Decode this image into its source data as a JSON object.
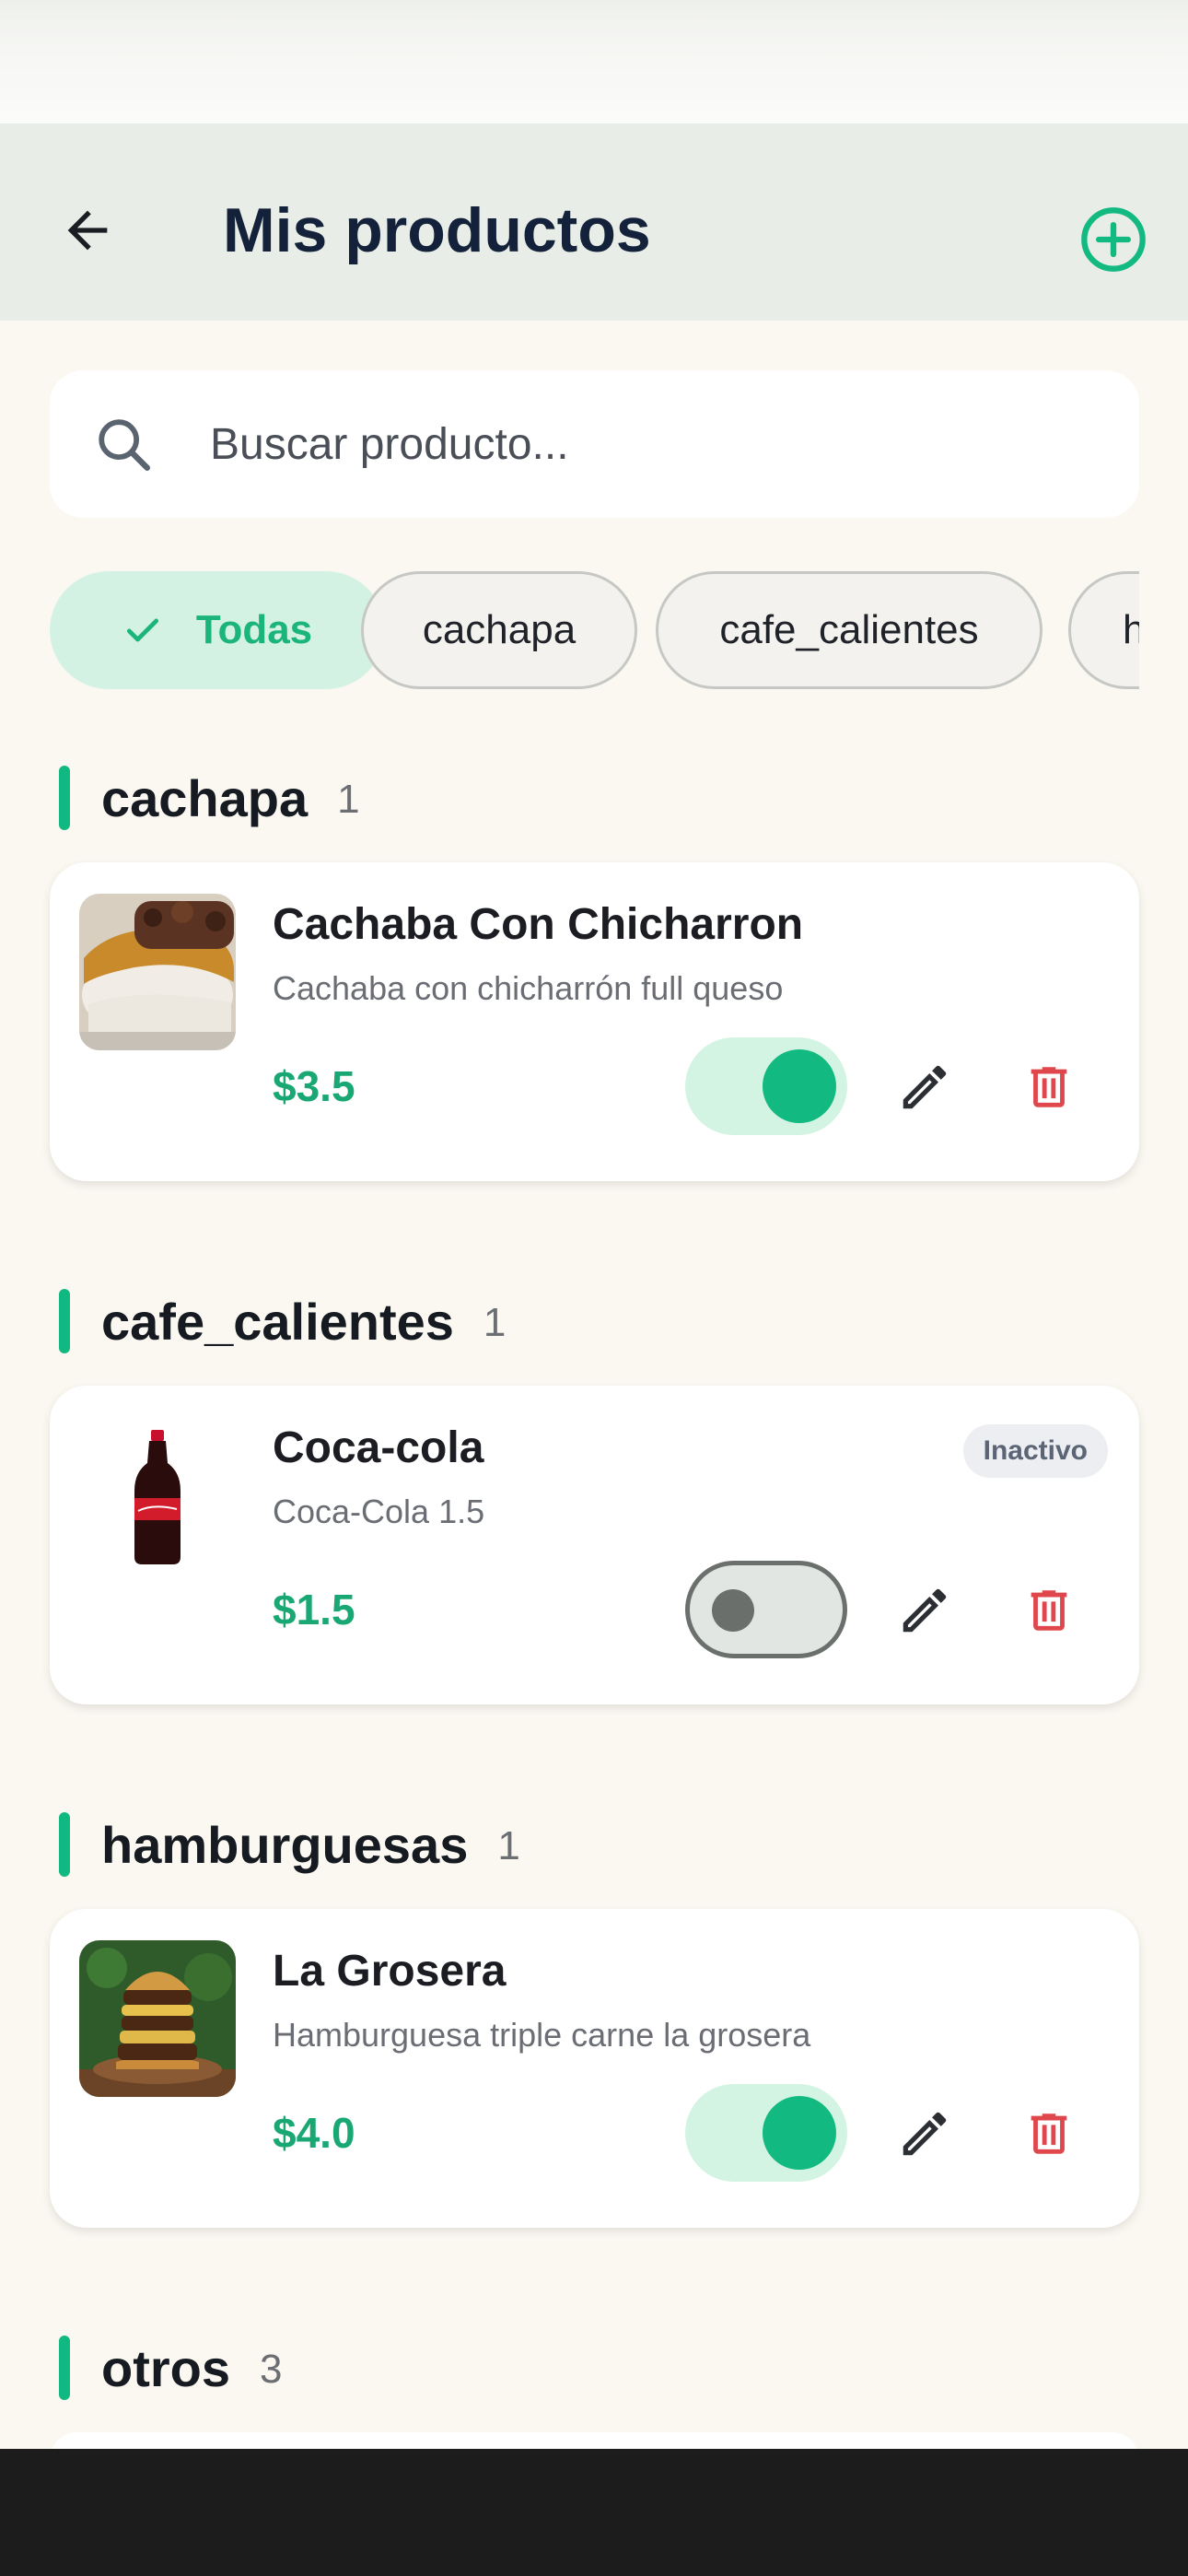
{
  "header": {
    "title": "Mis productos"
  },
  "search": {
    "placeholder": "Buscar producto..."
  },
  "filters": {
    "chips": [
      {
        "label": "Todas",
        "active": true
      },
      {
        "label": "cachapa",
        "active": false
      },
      {
        "label": "cafe_calientes",
        "active": false
      },
      {
        "label": "h",
        "active": false
      }
    ]
  },
  "sections": [
    {
      "name": "cachapa",
      "count": "1",
      "products": [
        {
          "name": "Cachaba Con Chicharron",
          "description": "Cachaba con chicharrón full queso",
          "price": "$3.5",
          "active": true,
          "badge": ""
        }
      ]
    },
    {
      "name": "cafe_calientes",
      "count": "1",
      "products": [
        {
          "name": "Coca-cola",
          "description": "Coca-Cola 1.5",
          "price": "$1.5",
          "active": false,
          "badge": "Inactivo"
        }
      ]
    },
    {
      "name": "hamburguesas",
      "count": "1",
      "products": [
        {
          "name": "La Grosera",
          "description": "Hamburguesa triple carne la grosera",
          "price": "$4.0",
          "active": true,
          "badge": ""
        }
      ]
    },
    {
      "name": "otros",
      "count": "3",
      "products": []
    }
  ],
  "colors": {
    "accent": "#10b981",
    "price": "#19a874",
    "delete": "#e0474c",
    "title": "#13213a"
  }
}
